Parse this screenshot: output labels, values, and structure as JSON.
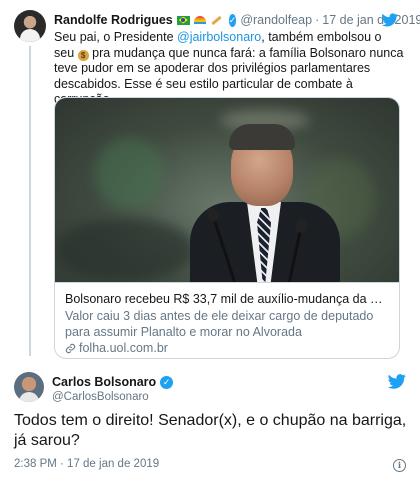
{
  "quoted_tweet": {
    "author_name": "Randolfe Rodrigues",
    "author_handle": "@randolfeap",
    "separator": "·",
    "date": "17 de jan de 2019",
    "text_pre": "Seu pai, o Presidente ",
    "mention": "@jairbolsonaro",
    "text_mid": ", também embolsou o seu ",
    "text_post": " pra mudança que nunca fará: a família Bolsonaro nunca teve pudor em se apoderar dos privilégios parlamentares descabidos. Esse é seu estilo particular de combate à corrupção.",
    "link_card": {
      "title": "Bolsonaro recebeu R$ 33,7 mil de auxílio-mudança da Câmara - ...",
      "description": "Valor caiu 3 dias antes de ele deixar cargo de deputado para assumir Planalto e morar no Alvorada",
      "domain": "folha.uol.com.br"
    }
  },
  "main_tweet": {
    "author_name": "Carlos Bolsonaro",
    "author_handle": "@CarlosBolsonaro",
    "text": "Todos tem o direito! Senador(x), e o chupão na barriga, já sarou?",
    "timestamp": "2:38 PM · 17 de jan de 2019",
    "info_glyph": "i"
  },
  "colors": {
    "twitter_blue": "#1da1f2",
    "link_blue": "#1b95e0",
    "secondary_text": "#657786",
    "border": "#ccd6dd"
  },
  "icons": [
    "brazil-flag-icon",
    "rainbow-icon",
    "pencil-icon",
    "verified-badge-icon",
    "twitter-bird-icon",
    "money-bag-icon",
    "link-icon",
    "info-icon"
  ]
}
